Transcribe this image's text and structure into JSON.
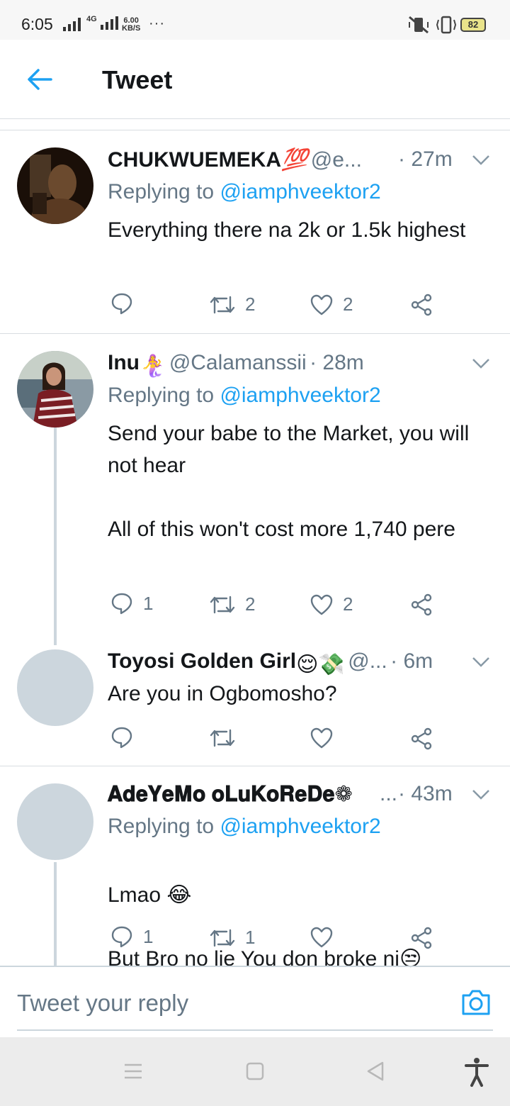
{
  "status_bar": {
    "time": "6:05",
    "network": "4G",
    "speed_value": "6.00",
    "speed_unit": "KB/S",
    "more": "···",
    "battery": "82"
  },
  "header": {
    "title": "Tweet"
  },
  "tweets": [
    {
      "name": "CHUKWUEMEKA",
      "name_emoji": "💯",
      "handle": "@e...",
      "time": "· 27m",
      "replying_prefix": "Replying to ",
      "replying_to": "@iamphveektor2",
      "text": "Everything there na 2k or 1.5k highest",
      "replies": "",
      "retweets": "2",
      "likes": "2"
    },
    {
      "name": "Inu",
      "name_emoji": "🧜‍♀️",
      "handle": "@Calamanssii",
      "time": "· 28m",
      "replying_prefix": "Replying to ",
      "replying_to": "@iamphveektor2",
      "text": "Send your babe to the Market, you will not hear\n\nAll of this won't cost more 1,740 pere",
      "replies": "1",
      "retweets": "2",
      "likes": "2"
    },
    {
      "name": "Toyosi Golden Girl",
      "name_emoji": "😌💸",
      "handle": "@...",
      "time": "· 6m",
      "text": "Are you in Ogbomosho?",
      "replies": "",
      "retweets": "",
      "likes": ""
    },
    {
      "name": "𝐀𝐝𝐞𝐘𝐞𝐌𝐨 𝐨𝐋𝐮𝐊𝐨𝐑𝐞𝐃𝐞❁",
      "handle": "...",
      "time": "· 43m",
      "replying_prefix": "Replying to ",
      "replying_to": "@iamphveektor2",
      "text_line1": "Lmao 😂",
      "text_line2": "But Bro no lie You don broke ni😒",
      "replies": "1",
      "retweets": "1",
      "likes": ""
    }
  ],
  "reply_bar": {
    "placeholder": "Tweet your reply"
  },
  "colors": {
    "accent": "#1da1f2",
    "secondary_text": "#657786",
    "primary_text": "#14171a",
    "divider": "#d8dde1",
    "avatar_placeholder": "#ccd6dd"
  }
}
